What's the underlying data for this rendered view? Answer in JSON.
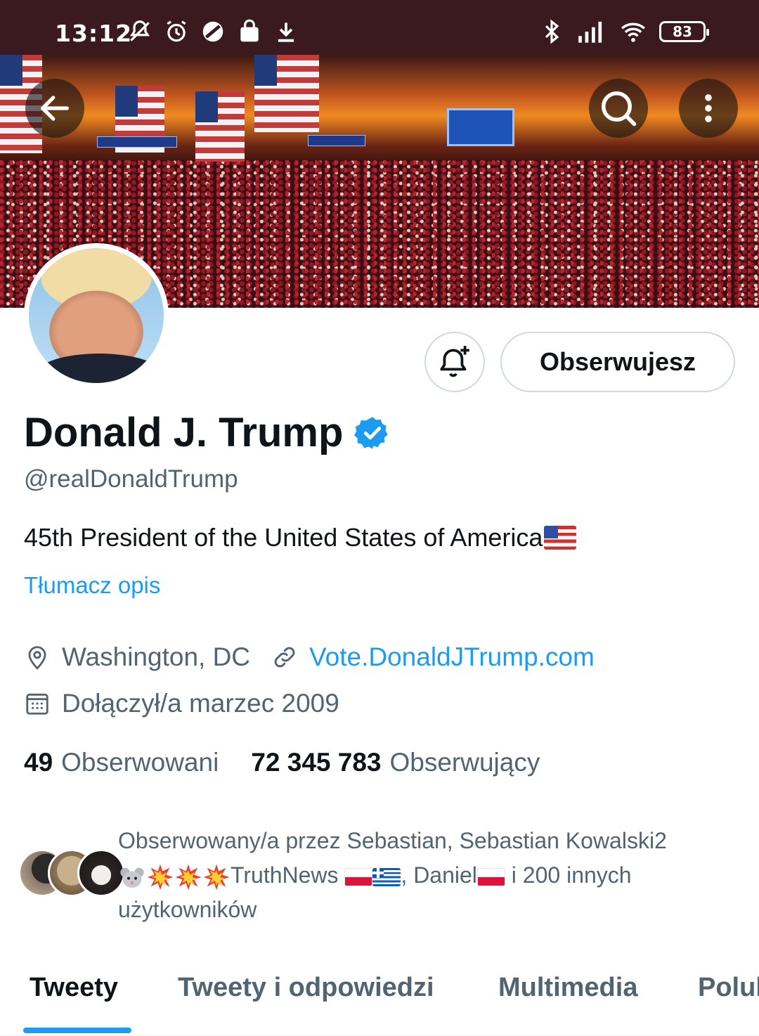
{
  "status_bar": {
    "time": "13:12",
    "battery": "83",
    "icons": [
      "mute-icon",
      "alarm-icon",
      "app-icon",
      "bag-icon",
      "download-icon",
      "bluetooth-icon",
      "signal-icon",
      "wifi-icon",
      "battery-icon"
    ]
  },
  "header": {
    "back_icon": "arrow-left-icon",
    "search_icon": "search-icon",
    "more_icon": "more-vertical-icon"
  },
  "profile": {
    "name": "Donald J. Trump",
    "verified_icon": "verified-badge-icon",
    "handle": "@realDonaldTrump",
    "bio": "45th President of the United States of America",
    "bio_flag": "us-flag-emoji",
    "translate_bio": "Tłumacz opis",
    "location": "Washington, DC",
    "website": "Vote.DonaldJTrump.com",
    "joined": "Dołączył/a marzec 2009"
  },
  "actions": {
    "notify_icon": "bell-plus-icon",
    "follow_label": "Obserwujesz"
  },
  "stats": {
    "following_count": "49",
    "following_label": "Obserwowani",
    "followers_count": "72 345 783",
    "followers_label": "Obserwujący"
  },
  "followed_by": {
    "prefix": "Obserwowany/a przez Sebastian, Sebastian Kowalski2",
    "name_truthnews": "TruthNews",
    "comma": ",",
    "name_daniel": "Daniel",
    "suffix": "i 200 innych",
    "suffix2": "użytkowników"
  },
  "tabs": [
    {
      "label": "Tweety",
      "active": true
    },
    {
      "label": "Tweety i odpowiedzi",
      "active": false
    },
    {
      "label": "Multimedia",
      "active": false
    },
    {
      "label": "Polubione",
      "active": false
    }
  ],
  "colors": {
    "accent": "#1d9bf0",
    "status_bar": "#3a1a1f",
    "text_primary": "#0f1419",
    "text_secondary": "#536471"
  }
}
